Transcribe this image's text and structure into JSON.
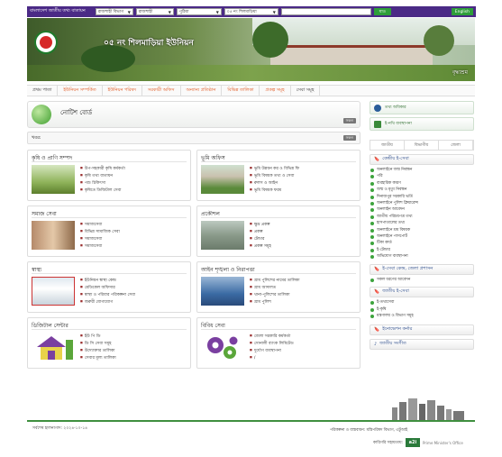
{
  "topbar": {
    "portal_label": "বাংলাদেশ জাতীয় তথ্য বাতায়ন",
    "division": "রাজশাহী বিভাগ",
    "district": "রাজশাহী",
    "upazila": "পুঠিয়া",
    "union": "০৫ নং শিলমাড়িয়া",
    "go_label": "যাও",
    "english_label": "English"
  },
  "banner": {
    "title": "০৫ নং শিলমাড়িয়া ইউনিয়ন",
    "caption": "বৃদ্ধাশ্রম"
  },
  "nav": {
    "items": [
      "প্রথম পাতা",
      "ইউনিয়ন সম্পর্কিত",
      "ইউনিয়ন পরিষদ",
      "সরকারী অফিস",
      "অন্যান্য প্রতিষ্ঠান",
      "বিভিন্ন তালিকা",
      "প্রকল্প সমূহ",
      "সেবা সমূহ"
    ]
  },
  "notice": {
    "title": "নোটিশ বোর্ড",
    "more": "সকল"
  },
  "news": {
    "label": "খবর:",
    "more": "সকল"
  },
  "sections": [
    {
      "title": "কৃষি ও প্রাণি সম্পদ",
      "items": [
        "উপ-সহকারী কৃষি কর্মকর্তা",
        "কৃষি তথ্য বাতায়ন",
        "পশু চিকিৎসা",
        "কৃষিতে ডিজিটাল সেবা"
      ]
    },
    {
      "title": "ভূমি অফিস",
      "items": [
        "ভূমি উন্নয়ন কর ও বিভিন্ন ফি",
        "ভূমি বিষয়ক তথ্য ও সেবা",
        "রুলস ও আইন",
        "ভূমি বিষয়ক ফরম"
      ]
    },
    {
      "title": "সমাজ সেবা",
      "items": [
        "সমাজসেবা",
        "বিভিন্ন সামাজিক সেবা",
        "সমাজসেবা",
        "সমাজসেবা"
      ]
    },
    {
      "title": "প্রকৌশল",
      "items": [
        "ক্ষুদ্র প্রকল্প",
        "প্রকল্প",
        "টেন্ডার",
        "প্রকল্প সমূহ"
      ]
    },
    {
      "title": "স্বাস্থ্য",
      "items": [
        "ইউনিয়ন স্বাস্থ্য কেন্দ্র",
        "মেডিকেল অফিসার",
        "স্বাস্থ্য ও পরিবার পরিকল্পনা সেবা",
        "জরুরী যোগাযোগ"
      ]
    },
    {
      "title": "আইন শৃঙ্খলা ও নিরাপত্তা",
      "items": [
        "গ্রাম পুলিশের নামের তালিকা",
        "গ্রাম আদালত",
        "থানা-পুলিশের তালিকা",
        "গ্রাম পুলিশ"
      ]
    },
    {
      "title": "ডিজিটাল সেন্টার",
      "items": [
        "ইউ পি ডি",
        "ডি সি সেবা সমূহ",
        "উদ্যোক্তার তালিকা",
        "সেবার মূল্য তালিকা"
      ]
    },
    {
      "title": "বিবিধ সেবা",
      "items": [
        "জেলা সরকারি কর্মকর্তা",
        "সোনালী ব্যাংক লিমিটেড",
        "দুর্যোগ ব্যবস্থাপনা",
        "/"
      ]
    }
  ],
  "sidebar": {
    "buttons": [
      "তথ্য অধিকার",
      "ই-নথি ব্যবস্থাপনা"
    ],
    "tabs": [
      "জাতীয়",
      "বিভাগীয়",
      "জেলা"
    ],
    "central_service_title": "কেন্দ্রীয় ই-সেবা",
    "central_service_items": [
      "অনলাইনে জন্ম নিবন্ধন",
      "পরি",
      "ব্যবহারিক কারণ",
      "জন্ম ও মৃত্যু নিবন্ধন",
      "দিনাজপুর সরকারি ভর্তি",
      "অনলাইনে পুলিশ ক্লিয়ারেন্স",
      "অনলাইন আবেদন",
      "জাতীয় পরিচয়পত্র তথ্য",
      "হাসপাতালের তথ্য",
      "অনলাইনে শ্রম বিষয়ক",
      "অনলাইনে পাসপোর্ট",
      "টিকা কার্ড",
      "ই-টেন্ডার",
      "অভিযোগ ব্যবস্থাপনা"
    ],
    "district_service_title": "ই-সেবা কেন্দ্র, জেলা প্রশাসন",
    "district_service_items": [
      "সকল ধরণের আবেদন"
    ],
    "national_service_title": "জাতীয় ই-সেবা",
    "national_service_items": [
      "ই-তথ্যসেবা",
      "ই-কৃষি",
      "মন্ত্রণালয় ও বিভাগ সমূহ"
    ],
    "extra_buttons": [
      "ইনোভেশন কর্নার",
      "জাতীয় সংগীত"
    ]
  },
  "footer": {
    "left": "সর্বশেষ হালনাগাদ: ২০২৪-১০-১৪",
    "right": "পরিকল্পনা ও বাস্তবায়ন: মন্ত্রিপরিষদ বিভাগ, এটুআই",
    "tech_label": "কারিগরি সহায়তায়:",
    "a2i": "a2i",
    "pmo": "Prime Minister's Office"
  }
}
